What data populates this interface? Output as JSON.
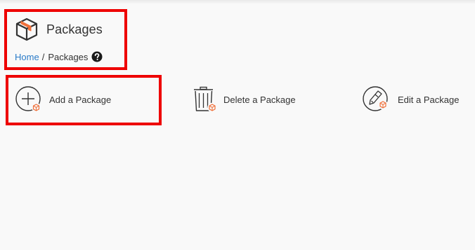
{
  "page": {
    "title": "Packages",
    "title_icon": "package-box-icon"
  },
  "breadcrumb": {
    "home_label": "Home",
    "separator": "/",
    "current_label": "Packages",
    "help_icon": "question-circle-icon"
  },
  "actions": [
    {
      "label": "Add a Package",
      "icon": "add-package-icon"
    },
    {
      "label": "Delete a Package",
      "icon": "delete-package-icon"
    },
    {
      "label": "Edit a Package",
      "icon": "edit-package-icon"
    }
  ],
  "colors": {
    "accent_orange": "#f0703a",
    "link_blue": "#2a7bc8",
    "highlight_red": "#ee0000",
    "text": "#333333",
    "background": "#f9f9f9"
  }
}
